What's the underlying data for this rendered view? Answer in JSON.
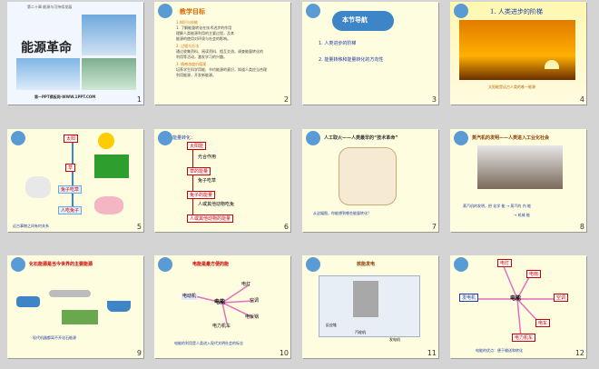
{
  "slides": [
    {
      "num": "1",
      "subtitle": "第二十章 能源与可持续发展",
      "title": "能源革命",
      "footer": "第一PPT模板网-WWW.1PPT.COM"
    },
    {
      "num": "2",
      "header": "教学目标",
      "lines": [
        "1.知识与技能",
        "1. 了解能量转化在技术进步的作用",
        "理解人类能源利用的主要过程，及其",
        "能源的使用对环境与社会的影响。",
        "2. 过程与方法",
        "通过收集资料、阅读资料、相互交流，调查能量转化的",
        "利用等活动，激发学习的兴趣。",
        "3. 情感态度价值观",
        "培养学生科学用能、节约能源的意识，知道人类应当合理",
        "利用能源，开发新能源。"
      ]
    },
    {
      "num": "3",
      "header": "本节导航",
      "lines": [
        "1. 人类进步的阶梯",
        "2. 能量转移和能量转化的方向性"
      ]
    },
    {
      "num": "4",
      "title": "1. 人类进步的阶梯",
      "caption": "太阳能是远古人类的唯一能源"
    },
    {
      "num": "5",
      "boxes": [
        "太阳",
        "草",
        "兔子吃草",
        "人吃兔子"
      ],
      "caption": "远古事物之间有何关系"
    },
    {
      "num": "6",
      "header": "能量转化：",
      "steps": [
        "太阳能",
        "光合作用",
        "草的能量",
        "兔子吃草",
        "兔子的能量",
        "人或其他动物吃兔",
        "人或其他动物的能量"
      ]
    },
    {
      "num": "7",
      "title": "人工取火——人类最早的“技术革命”",
      "caption": "从这幅图，你能想到哪些能量转化？"
    },
    {
      "num": "8",
      "title": "蒸汽机的发明——人类进入工业化社会",
      "line1": "蒸汽机的发明，把 化学 能 → 蒸汽的 内 能",
      "line2": "→ 机械 能"
    },
    {
      "num": "9",
      "title": "化石能源是当今世界的主要能源",
      "caption": "现代机器都离不开化石能源"
    },
    {
      "num": "10",
      "title": "电能是最方便的能",
      "center": "电能",
      "items": [
        "电动机",
        "电灯",
        "空调",
        "电力机车",
        "电饭锅"
      ],
      "caption": "电能的利用是人类进入现代文明社会的标志"
    },
    {
      "num": "11",
      "title": "核能发电",
      "labels": [
        "反应堆",
        "汽轮机",
        "发电机"
      ]
    },
    {
      "num": "12",
      "center": "电能",
      "items": [
        "电灯",
        "电扇",
        "空调",
        "电车",
        "电力机车",
        "发电机"
      ],
      "caption": "电能的优点：便于输送和转化"
    }
  ]
}
